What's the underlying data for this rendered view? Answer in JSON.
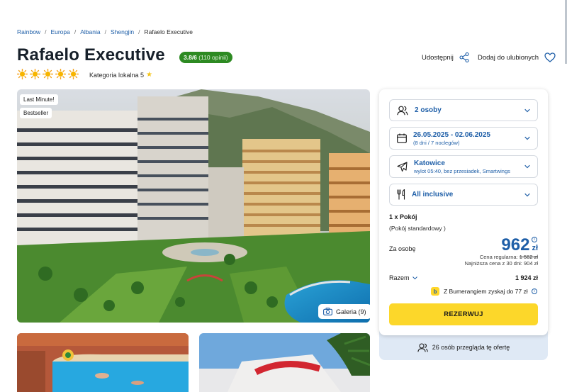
{
  "breadcrumb": [
    "Rainbow",
    "Europa",
    "Albania",
    "Shengjin",
    "Rafaelo Executive"
  ],
  "hotel": {
    "name": "Rafaelo Executive",
    "rating": "3.8/6",
    "rating_count": "(110 opinii)",
    "suns": 5,
    "category": "Kategoria lokalna 5"
  },
  "actions": {
    "share": "Udostępnij",
    "favorite": "Dodaj do ulubionych"
  },
  "photo": {
    "tags": [
      "Last Minute!",
      "Bestseller"
    ],
    "gallery": "Galeria (9)"
  },
  "booking": {
    "persons": "2 osoby",
    "dates": "26.05.2025 - 02.06.2025",
    "dates_sub": "(8 dni / 7 noclegów)",
    "departure": "Katowice",
    "departure_sub": "wylot 05:40, bez przesiadek, Smartwings",
    "board": "All inclusive",
    "room_qty": "1 x Pokój",
    "room_name": "(Pokój standardowy )",
    "per_person_label": "Za osobę",
    "price": "962",
    "currency": "zł",
    "regular_label": "Cena regularna:",
    "regular_price": "1 562 zł",
    "lowest_30": "Najniższa cena z 30 dni: 904 zł",
    "total_label": "Razem",
    "total_value": "1 924 zł",
    "bumerang": "Z Bumerangiem zyskaj do 77 zł",
    "reserve": "REZERWUJ",
    "viewers": "26 osób przegląda tę ofertę"
  },
  "colors": {
    "brand_blue": "#1f5fa8",
    "rating_green": "#2d8a22",
    "cta_yellow": "#fcd72a"
  }
}
